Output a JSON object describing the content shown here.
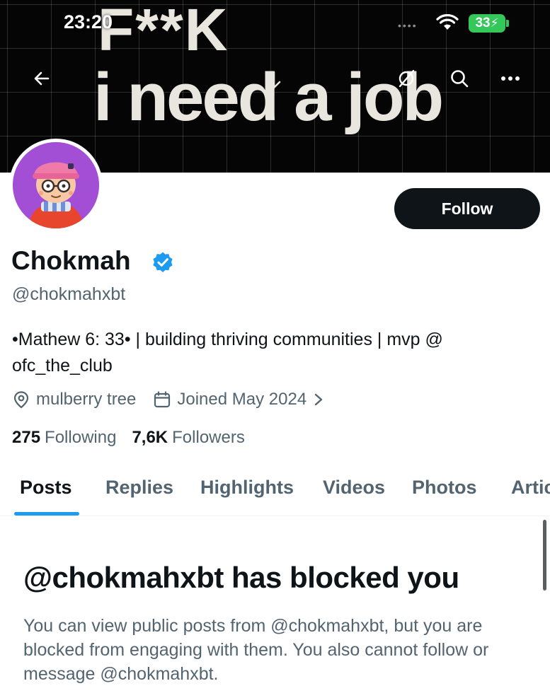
{
  "status_bar": {
    "time": "23:20",
    "battery": "33"
  },
  "banner": {
    "line1": "F**K",
    "line2": "i need a job"
  },
  "profile": {
    "display_name": "Chokmah",
    "handle": "@chokmahxbt",
    "follow_label": "Follow",
    "bio": "•Mathew 6: 33• | building thriving communities | mvp @ ofc_the_club",
    "location": "mulberry tree",
    "joined": "Joined May 2024",
    "following_count": "275",
    "following_label": "Following",
    "followers_count": "7,6K",
    "followers_label": "Followers",
    "verified_color": "#1d9bf0"
  },
  "tabs": [
    "Posts",
    "Replies",
    "Highlights",
    "Videos",
    "Photos",
    "Articles"
  ],
  "active_tab": "Posts",
  "blocked": {
    "title": "@chokmahxbt has blocked you",
    "body": "You can view public posts from @chokmahxbt, but you are blocked from engaging with them. You also cannot follow or message @chokmahxbt."
  },
  "icons": {
    "back": "arrow-left-icon",
    "search": "search-icon",
    "more": "more-horizontal-icon",
    "location": "location-pin-icon",
    "calendar": "calendar-icon",
    "verified": "verified-badge-icon"
  },
  "colors": {
    "accent": "#1d9bf0",
    "text_primary": "#0f1419",
    "text_secondary": "#536471",
    "battery": "#34c759"
  }
}
